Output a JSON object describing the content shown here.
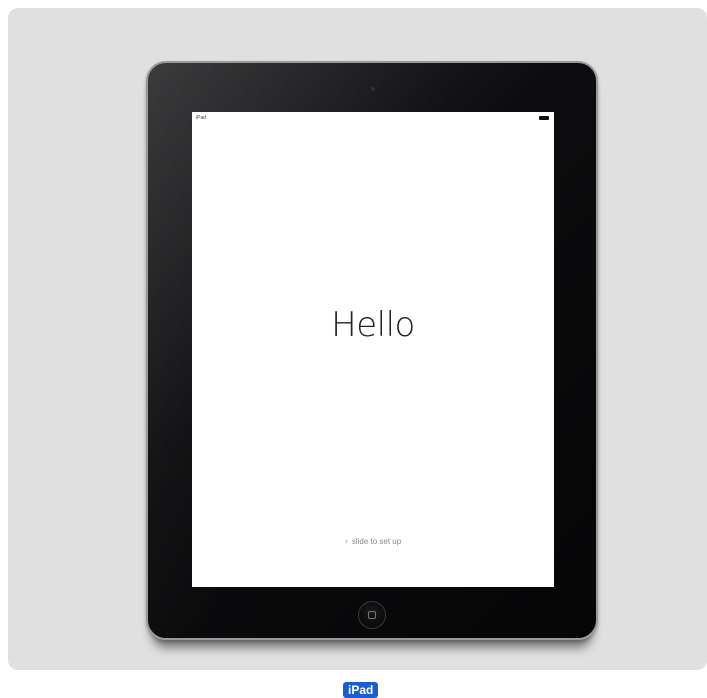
{
  "device": {
    "name_label": "iPad",
    "status_bar": {
      "carrier": "iPad"
    },
    "screen": {
      "greeting": "Hello",
      "slide_chevron": "›",
      "slide_text": "slide to set up"
    },
    "icons": {
      "battery": "battery-icon",
      "home_button": "home-button-icon",
      "chevron": "chevron-right-icon",
      "camera": "camera-icon"
    }
  },
  "colors": {
    "panel_background": "#e0e0e0",
    "bezel": "#0d0d0f",
    "screen": "#ffffff",
    "label_background": "#1a5fd0"
  }
}
